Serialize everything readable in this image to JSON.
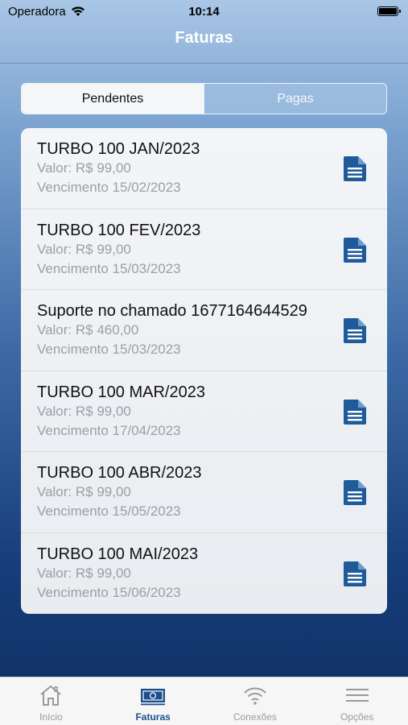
{
  "status_bar": {
    "carrier": "Operadora",
    "time": "10:14"
  },
  "nav": {
    "title": "Faturas"
  },
  "segments": [
    {
      "label": "Pendentes",
      "active": true
    },
    {
      "label": "Pagas",
      "active": false
    }
  ],
  "invoices": [
    {
      "title": "TURBO 100 JAN/2023",
      "value": "Valor: R$ 99,00",
      "due": "Vencimento 15/02/2023"
    },
    {
      "title": "TURBO 100 FEV/2023",
      "value": "Valor: R$ 99,00",
      "due": "Vencimento 15/03/2023"
    },
    {
      "title": "Suporte no chamado 1677164644529",
      "value": "Valor: R$ 460,00",
      "due": "Vencimento 15/03/2023"
    },
    {
      "title": "TURBO 100 MAR/2023",
      "value": "Valor: R$ 99,00",
      "due": "Vencimento 17/04/2023"
    },
    {
      "title": "TURBO 100 ABR/2023",
      "value": "Valor: R$ 99,00",
      "due": "Vencimento 15/05/2023"
    },
    {
      "title": "TURBO 100 MAI/2023",
      "value": "Valor: R$ 99,00",
      "due": "Vencimento 15/06/2023"
    }
  ],
  "tabs": [
    {
      "label": "Início",
      "icon": "home-icon",
      "active": false
    },
    {
      "label": "Faturas",
      "icon": "invoice-icon",
      "active": true
    },
    {
      "label": "Conexões",
      "icon": "wifi-icon",
      "active": false
    },
    {
      "label": "Opções",
      "icon": "menu-icon",
      "active": false
    }
  ],
  "colors": {
    "accent": "#1d4f8c",
    "doc_icon": "#1f5a9a",
    "muted_text": "#9aa0a6"
  }
}
